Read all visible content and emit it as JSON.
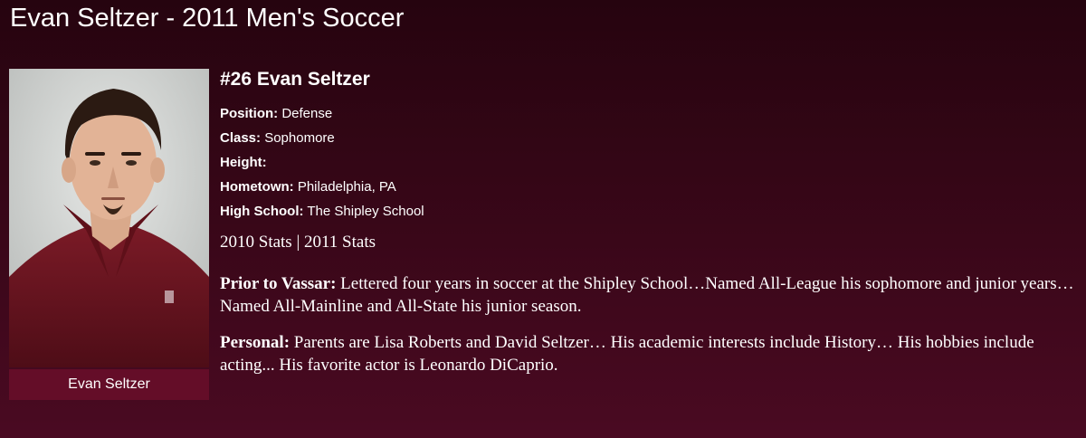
{
  "page": {
    "title": "Evan Seltzer - 2011 Men's Soccer"
  },
  "photo": {
    "caption": "Evan Seltzer"
  },
  "player": {
    "heading": "#26 Evan Seltzer",
    "fields": [
      {
        "label": "Position:",
        "value": " Defense"
      },
      {
        "label": "Class:",
        "value": " Sophomore"
      },
      {
        "label": "Height:",
        "value": ""
      },
      {
        "label": "Hometown:",
        "value": " Philadelphia, PA"
      },
      {
        "label": "High School:",
        "value": " The Shipley School"
      }
    ]
  },
  "stats": {
    "link_2010": "2010 Stats",
    "separator": " | ",
    "link_2011": "2011 Stats"
  },
  "bio": {
    "prior_label": "Prior to Vassar:",
    "prior_text": " Lettered four years in soccer at the Shipley School…Named All-League his sophomore and junior years… Named All-Mainline and All-State his junior season.",
    "personal_label": "Personal:",
    "personal_text": " Parents are Lisa Roberts and David Seltzer… His academic interests include History… His hobbies include acting... His favorite actor is Leonardo DiCaprio."
  },
  "colors": {
    "background_top": "#26040f",
    "background_bottom": "#4a0a22",
    "caption_bar": "#640d28",
    "text": "#ffffff"
  }
}
